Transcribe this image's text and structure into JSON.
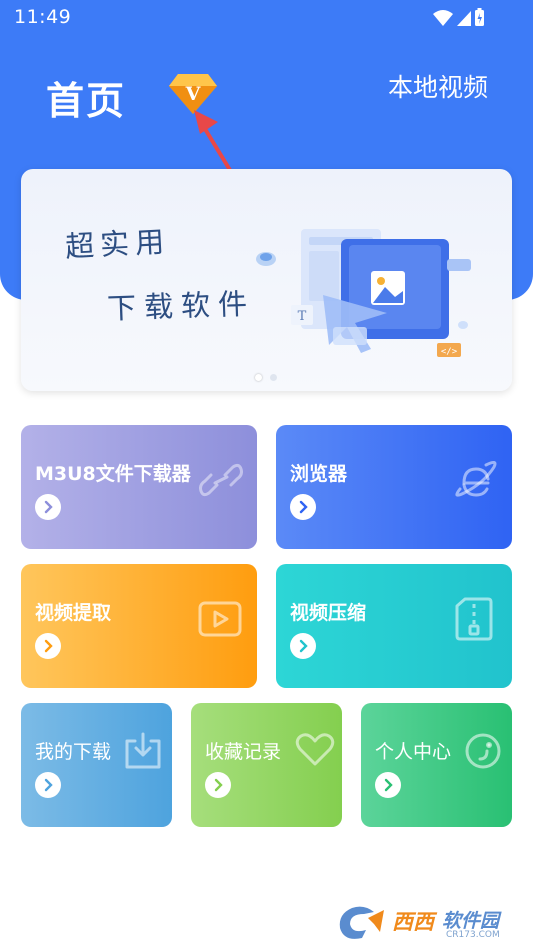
{
  "status_bar": {
    "time": "11:49"
  },
  "header": {
    "title": "首页",
    "vip_badge_letter": "V",
    "local_video_label": "本地视频",
    "accent": "#3d7bf7"
  },
  "banner": {
    "line1": "超实用",
    "line2": "下载软件",
    "code_tag": "</>",
    "text_tag": "T"
  },
  "features": {
    "m3u8": {
      "label": "M3U8文件下载器",
      "icon": "link-icon"
    },
    "browser": {
      "label": "浏览器",
      "icon": "browser-e-icon"
    },
    "extract": {
      "label": "视频提取",
      "icon": "play-video-icon"
    },
    "compress": {
      "label": "视频压缩",
      "icon": "zip-file-icon"
    },
    "downloads": {
      "label": "我的下载",
      "icon": "download-icon"
    },
    "favorites": {
      "label": "收藏记录",
      "icon": "heart-icon"
    },
    "profile": {
      "label": "个人中心",
      "icon": "smile-icon"
    }
  },
  "watermark": {
    "brand": "西西",
    "suffix": "软件园",
    "url": "CR173.COM"
  }
}
